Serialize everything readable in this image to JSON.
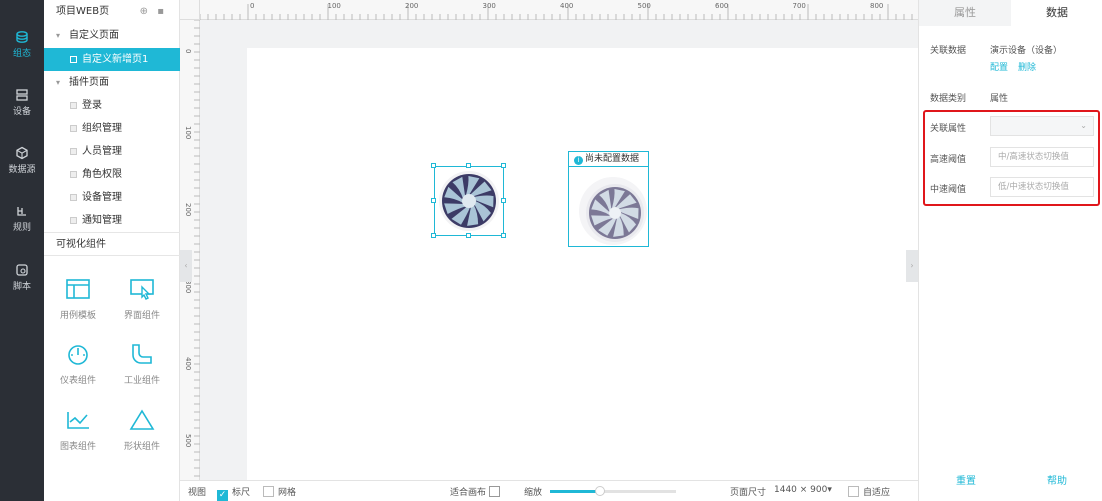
{
  "rail": {
    "items": [
      {
        "label": "组态",
        "icon": "layers-icon",
        "active": true
      },
      {
        "label": "设备",
        "icon": "device-icon",
        "active": false
      },
      {
        "label": "数据源",
        "icon": "datasource-icon",
        "active": false
      },
      {
        "label": "规则",
        "icon": "rules-icon",
        "active": false
      },
      {
        "label": "脚本",
        "icon": "script-icon",
        "active": false
      }
    ]
  },
  "tree": {
    "title": "项目WEB页",
    "groups": {
      "custom": "自定义页面",
      "custom_page": "自定义新增页1",
      "plugin": "插件页面"
    },
    "plugin_pages": [
      "登录",
      "组织管理",
      "人员管理",
      "角色权限",
      "设备管理",
      "通知管理"
    ],
    "section": "可视化组件",
    "components": [
      "用例模板",
      "界面组件",
      "仪表组件",
      "工业组件",
      "图表组件",
      "形状组件"
    ]
  },
  "canvas": {
    "ruler_top": [
      "0",
      "100",
      "200",
      "300",
      "400",
      "500",
      "600",
      "700",
      "800"
    ],
    "ruler_left": [
      "0",
      "100",
      "200",
      "300",
      "400",
      "500"
    ],
    "nodata_label": "尚未配置数据"
  },
  "bottombar": {
    "view": "视图",
    "ruler": "标尺",
    "grid": "网格",
    "fit": "适合画布",
    "zoom": "缩放",
    "zoom_fraction": 0.4,
    "page_size_label": "页面尺寸",
    "page_size": "1440 × 900",
    "adaptive": "自适应"
  },
  "right": {
    "tabs": [
      "属性",
      "数据"
    ],
    "assoc_label": "关联数据",
    "assoc_value": "演示设备（设备）",
    "config_link": "配置",
    "delete_link": "删除",
    "type_label": "数据类别",
    "type_value": "属性",
    "attr_label": "关联属性",
    "attr_value": "",
    "high_label": "高速阈值",
    "high_placeholder": "中/高速状态切换值",
    "mid_label": "中速阈值",
    "mid_placeholder": "低/中速状态切换值",
    "reset": "重置",
    "help": "帮助"
  },
  "colors": {
    "accent": "#1fb8d6",
    "rail": "#2b2f36",
    "highlight": "#e0161b"
  }
}
